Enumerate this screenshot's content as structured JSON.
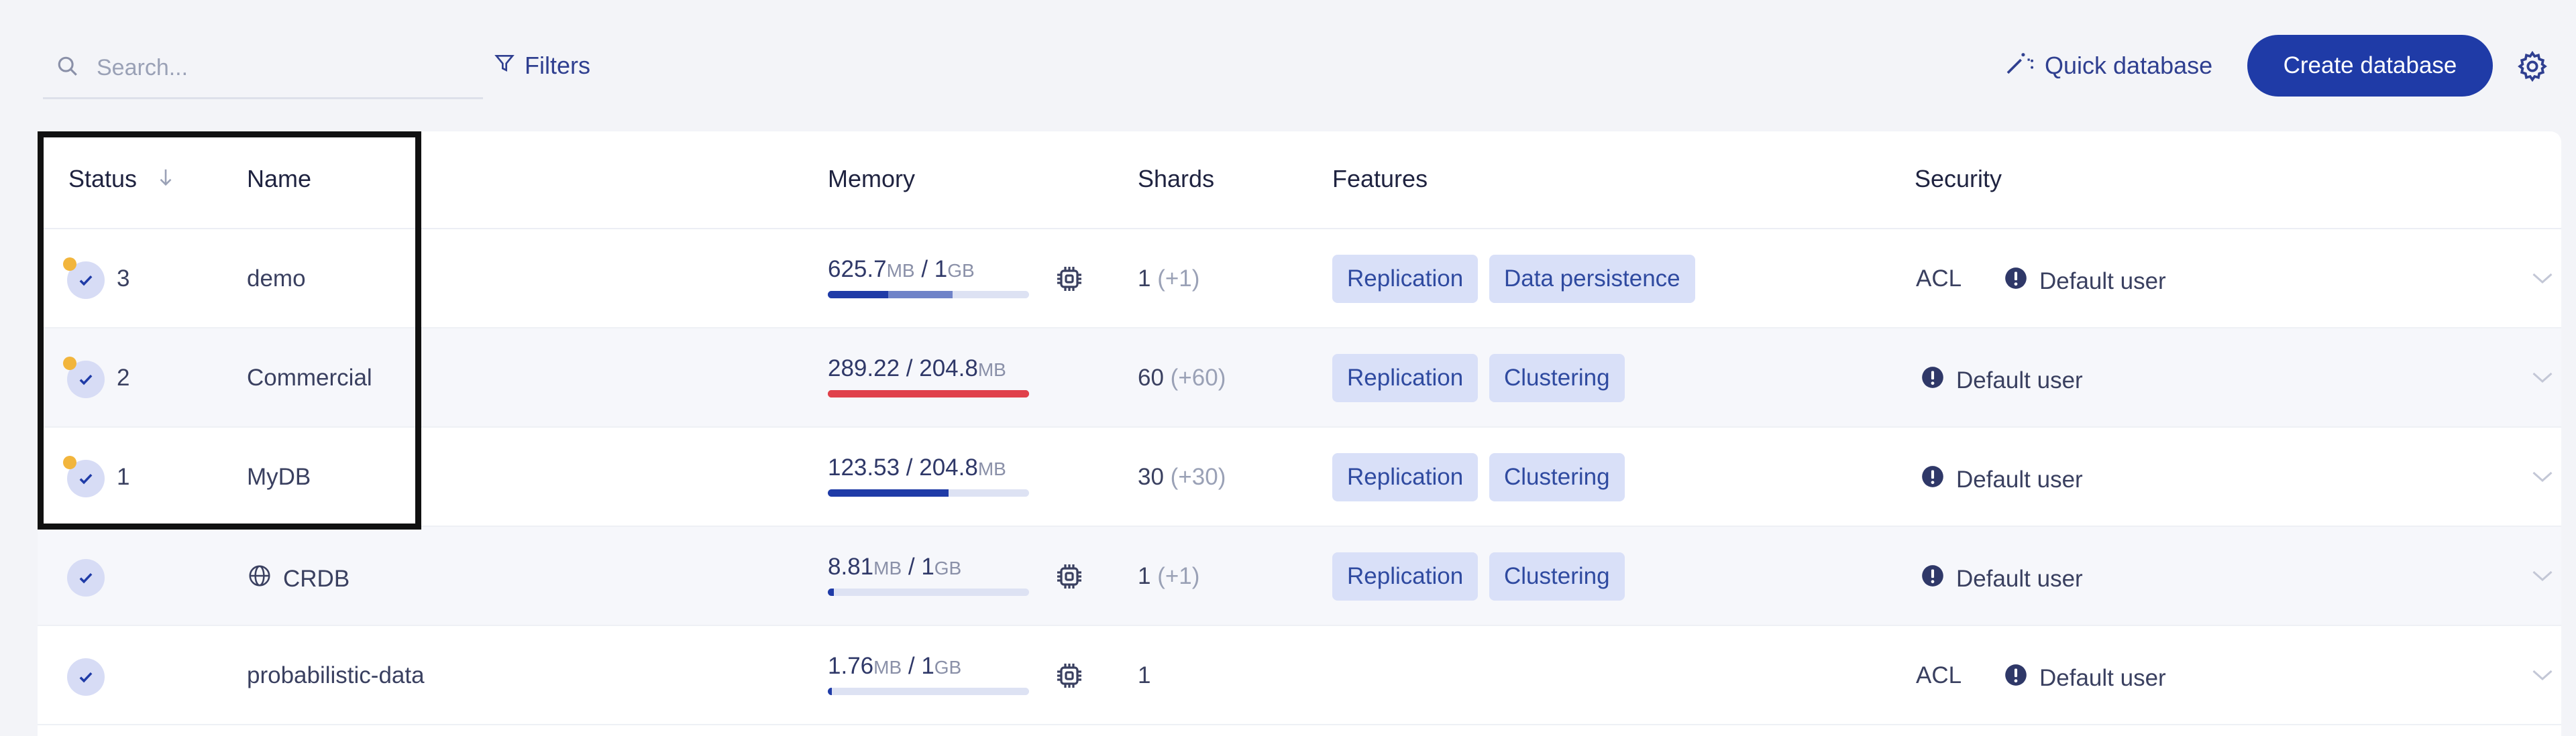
{
  "toolbar": {
    "search_placeholder": "Search...",
    "filters_label": "Filters",
    "quick_database_label": "Quick database",
    "create_database_label": "Create database"
  },
  "table": {
    "headers": {
      "status": "Status",
      "name": "Name",
      "memory": "Memory",
      "shards": "Shards",
      "features": "Features",
      "security": "Security"
    },
    "rows": [
      {
        "status_count": "3",
        "name": "demo",
        "memory_used": "625.7",
        "memory_used_unit": "MB",
        "memory_separator": " / ",
        "memory_limit": "1",
        "memory_limit_unit": "GB",
        "memory_fraction": 0.3,
        "memory_fraction_secondary": 0.62,
        "shards": "1",
        "shards_extra": "(+1)",
        "features": [
          "Replication",
          "Data persistence"
        ],
        "acl": "ACL",
        "security": "Default user"
      },
      {
        "status_count": "2",
        "name": "Commercial",
        "memory_used": "289.22",
        "memory_used_unit": "",
        "memory_separator": " / ",
        "memory_limit": "204.8",
        "memory_limit_unit": "MB",
        "memory_fraction": 1.0,
        "memory_over_limit": true,
        "shards": "60",
        "shards_extra": "(+60)",
        "features": [
          "Replication",
          "Clustering"
        ],
        "security": "Default user"
      },
      {
        "status_count": "1",
        "name": "MyDB",
        "memory_used": "123.53",
        "memory_used_unit": "",
        "memory_separator": " / ",
        "memory_limit": "204.8",
        "memory_limit_unit": "MB",
        "memory_fraction": 0.6,
        "shards": "30",
        "shards_extra": "(+30)",
        "features": [
          "Replication",
          "Clustering"
        ],
        "security": "Default user"
      },
      {
        "status_count": "",
        "name": "CRDB",
        "name_icon": "globe-icon",
        "memory_used": "8.81",
        "memory_used_unit": "MB",
        "memory_separator": " / ",
        "memory_limit": "1",
        "memory_limit_unit": "GB",
        "memory_fraction": 0.03,
        "shards": "1",
        "shards_extra": "(+1)",
        "features": [
          "Replication",
          "Clustering"
        ],
        "security": "Default user"
      },
      {
        "status_count": "",
        "name": "probabilistic-data",
        "memory_used": "1.76",
        "memory_used_unit": "MB",
        "memory_separator": " / ",
        "memory_limit": "1",
        "memory_limit_unit": "GB",
        "memory_fraction": 0.02,
        "shards": "1",
        "shards_extra": "",
        "features": [],
        "acl": "ACL",
        "security": "Default user"
      }
    ]
  },
  "colors": {
    "accent": "#1f3ba7",
    "feature_tag_bg": "#d9e0f8",
    "warning_dot": "#f2b53c",
    "over_limit_bar": "#e0414b"
  },
  "icons": [
    "search-icon",
    "filter-icon",
    "magic-wand-icon",
    "gear-icon",
    "sort-arrow-icon",
    "check-icon",
    "globe-icon",
    "cpu-chip-icon",
    "info-icon",
    "chevron-down-icon"
  ]
}
